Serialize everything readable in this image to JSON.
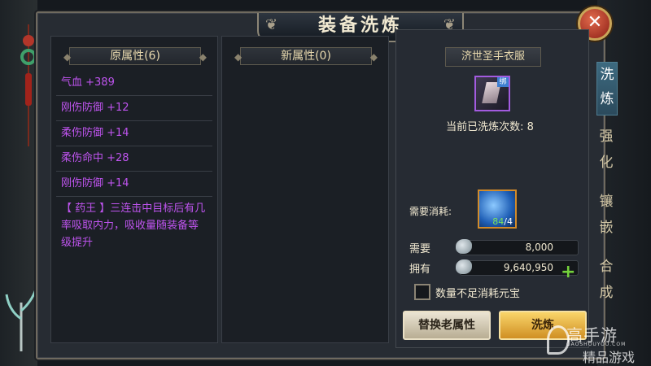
{
  "window": {
    "title": "装备洗炼",
    "close_label": "✕"
  },
  "original_panel": {
    "header": "原属性(6)",
    "attributes": [
      "气血 +389",
      "刚伤防御 +12",
      "柔伤防御 +14",
      "柔伤命中 +28",
      "刚伤防御 +14"
    ],
    "skill_text": "【 药王 】三连击中目标后有几率吸取内力，吸收量随装备等级提升"
  },
  "new_panel": {
    "header": "新属性(0)"
  },
  "item": {
    "name": "济世圣手衣服",
    "bound_badge": "绑",
    "wash_count_text": "当前已洗炼次数: 8"
  },
  "cost": {
    "label": "需要消耗:",
    "material_have": "84",
    "material_need": "/4",
    "need_label": "需要",
    "need_value": "8,000",
    "own_label": "拥有",
    "own_value": "9,640,950",
    "plus_label": "+"
  },
  "option": {
    "insufficient_label": "数量不足消耗元宝",
    "checked": false
  },
  "buttons": {
    "replace_label": "替换老属性",
    "wash_label": "洗炼"
  },
  "side_tabs": [
    "洗",
    "炼",
    "强",
    "化",
    "镶",
    "嵌",
    "合",
    "成"
  ],
  "watermark": {
    "main": "高手游",
    "sub": "GAOSHOUYOU.COM",
    "tag": "精品游戏"
  },
  "colors": {
    "attribute_purple": "#bf54ef",
    "accent_gold": "#d08f23",
    "plus_green": "#74d23c"
  }
}
